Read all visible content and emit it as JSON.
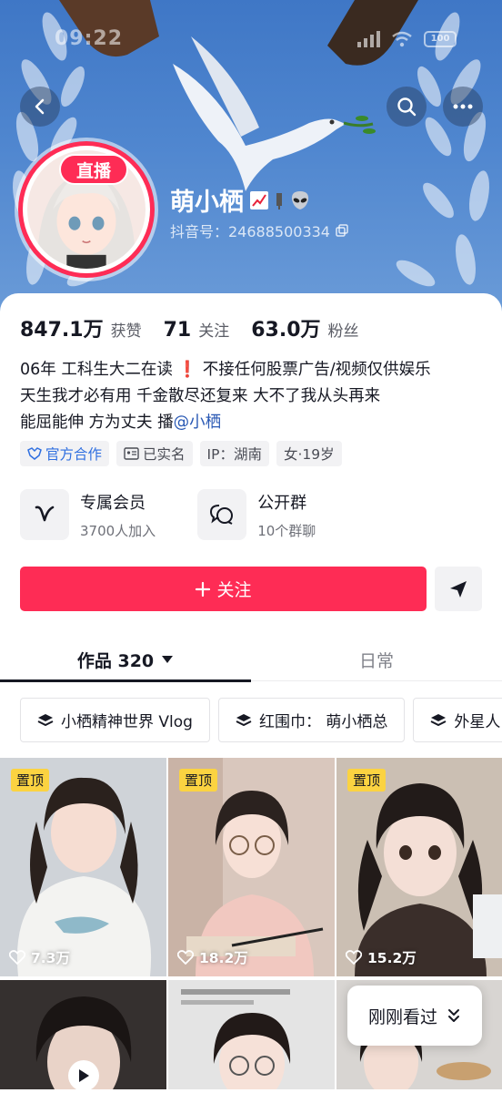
{
  "status_bar": {
    "time": "09:22",
    "battery": "100"
  },
  "header": {
    "live_badge": "直播",
    "name": "萌小栖",
    "douyin_id": "抖音号：24688500334"
  },
  "stats": [
    {
      "value": "847.1万",
      "label": "获赞"
    },
    {
      "value": "71",
      "label": "关注"
    },
    {
      "value": "63.0万",
      "label": "粉丝"
    }
  ],
  "bio": {
    "line1_a": "06年  工科生大二在读  ",
    "line1_b": "❗",
    "line1_c": " 不接任何股票广告/视频仅供娱乐",
    "line2": "天生我才必有用 千金散尽还复来 大不了我从头再来",
    "line3_a": "能屈能伸 方为丈夫 播",
    "line3_link": "@小栖"
  },
  "tags": {
    "official": "官方合作",
    "verified": "已实名",
    "ip": "IP：湖南",
    "gender_age": "女·19岁"
  },
  "groups": [
    {
      "title": "专属会员",
      "sub": "3700人加入",
      "icon": "v-member-icon"
    },
    {
      "title": "公开群",
      "sub": "10个群聊",
      "icon": "chat-group-icon"
    }
  ],
  "follow_button": "关注",
  "tabs": {
    "works": "作品 320",
    "daily": "日常"
  },
  "collections": [
    {
      "label": "小栖精神世界 Vlog"
    },
    {
      "label": "红围巾：  萌小栖总"
    },
    {
      "label": "外星人"
    }
  ],
  "videos": [
    {
      "pinned": "置顶",
      "likes": "7.3万"
    },
    {
      "pinned": "置顶",
      "likes": "18.2万"
    },
    {
      "pinned": "置顶",
      "likes": "15.2万"
    }
  ],
  "just_watched": "刚刚看过",
  "colors": {
    "accent": "#fe2c55",
    "link": "#2a59b4",
    "pin": "#fbd341"
  }
}
